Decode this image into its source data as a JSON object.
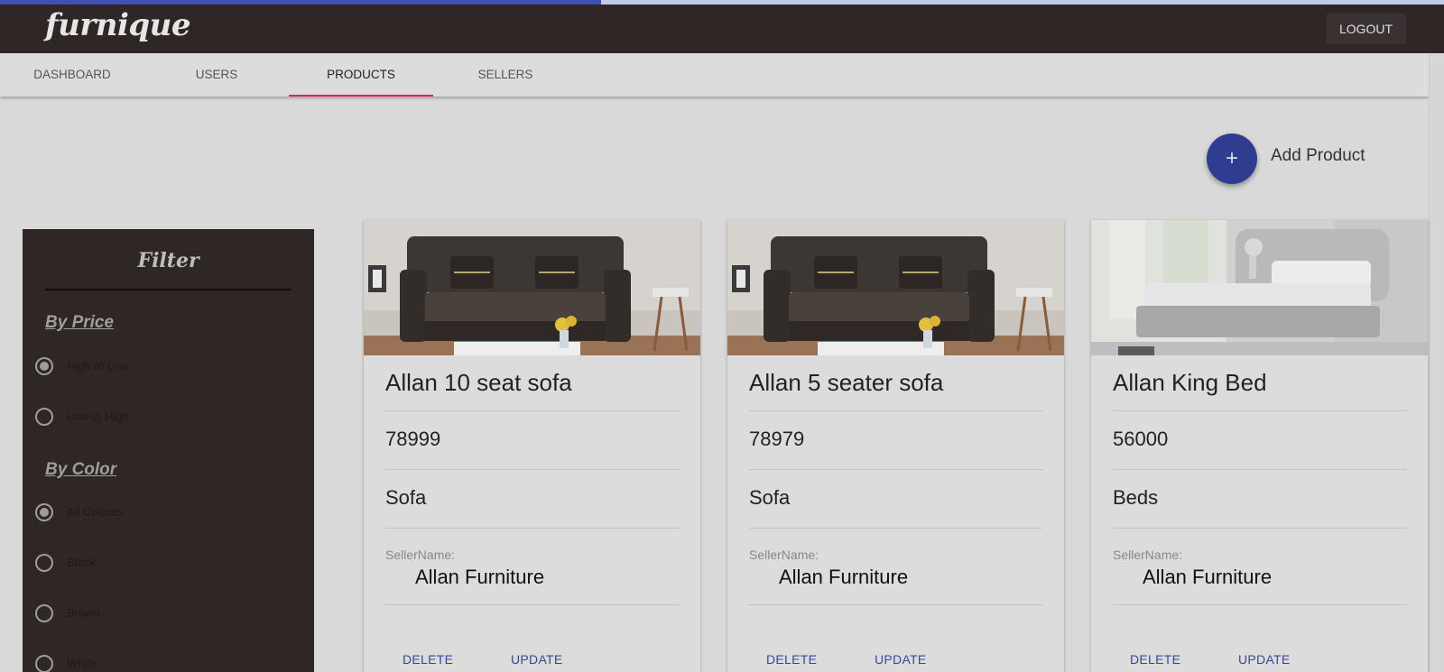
{
  "progress": {
    "percent": 41.6
  },
  "appbar": {
    "logo": "furnique",
    "logout_label": "LOGOUT"
  },
  "tabs": [
    {
      "label": "DASHBOARD",
      "active": false
    },
    {
      "label": "USERS",
      "active": false
    },
    {
      "label": "PRODUCTS",
      "active": true
    },
    {
      "label": "SELLERS",
      "active": false
    }
  ],
  "add_product": {
    "icon": "plus-icon",
    "icon_glyph": "+",
    "label": "Add Product"
  },
  "filter": {
    "title": "Filter",
    "by_price": {
      "heading": "By Price",
      "options": [
        {
          "label": "High to Low",
          "checked": true
        },
        {
          "label": "Low to High",
          "checked": false
        }
      ]
    },
    "by_color": {
      "heading": "By Color",
      "options": [
        {
          "label": "All Colours",
          "checked": true
        },
        {
          "label": "Black",
          "checked": false
        },
        {
          "label": "Brown",
          "checked": false
        },
        {
          "label": "White",
          "checked": false
        }
      ]
    }
  },
  "products": [
    {
      "name": "Allan 10 seat sofa",
      "price": "78999",
      "category": "Sofa",
      "seller_caption": "SellerName:",
      "seller_name": "Allan Furniture",
      "image": "sofa-image",
      "delete_label": "DELETE",
      "update_label": "UPDATE"
    },
    {
      "name": "Allan 5 seater sofa",
      "price": "78979",
      "category": "Sofa",
      "seller_caption": "SellerName:",
      "seller_name": "Allan Furniture",
      "image": "sofa-image",
      "delete_label": "DELETE",
      "update_label": "UPDATE"
    },
    {
      "name": "Allan King Bed",
      "price": "56000",
      "category": "Beds",
      "seller_caption": "SellerName:",
      "seller_name": "Allan Furniture",
      "image": "bed-image",
      "delete_label": "DELETE",
      "update_label": "UPDATE"
    }
  ],
  "colors": {
    "appbar": "#2f2626",
    "accent": "#3f51b5",
    "tab_indicator": "#e91e63",
    "fab": "#2f3d91"
  }
}
